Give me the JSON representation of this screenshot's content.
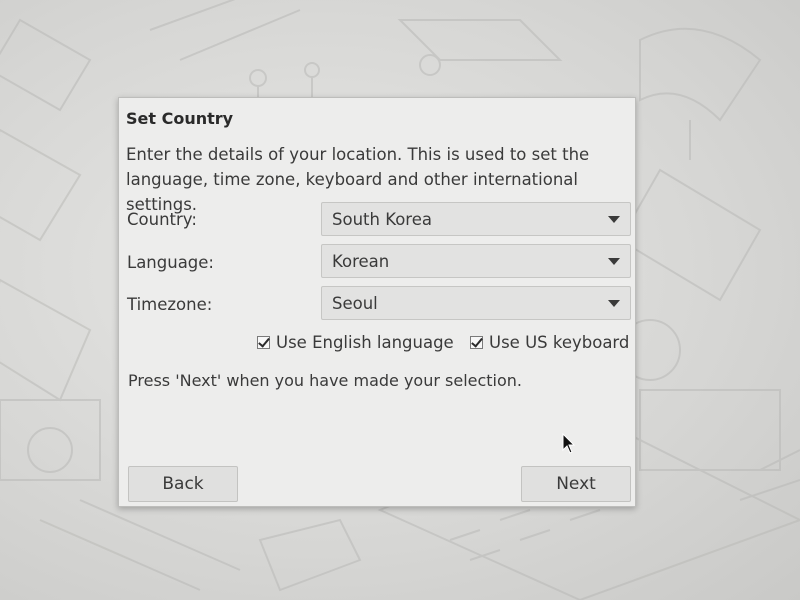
{
  "dialog": {
    "title": "Set Country",
    "description": "Enter the details of your location. This is used to set the language, time zone, keyboard and other international settings.",
    "fields": [
      {
        "label": "Country:",
        "value": "South Korea"
      },
      {
        "label": "Language:",
        "value": "Korean"
      },
      {
        "label": "Timezone:",
        "value": "Seoul"
      }
    ],
    "checkboxes": [
      {
        "label": "Use English language",
        "checked": true
      },
      {
        "label": "Use US keyboard",
        "checked": true
      }
    ],
    "hint": "Press 'Next' when you have made your selection.",
    "back_label": "Back",
    "next_label": "Next"
  },
  "icons": {
    "dropdown": "chevron-down-icon",
    "checkbox": "checkbox-checked-icon",
    "cursor": "mouse-pointer-icon"
  },
  "colors": {
    "dialog_bg": "#ededec",
    "wallpaper": "#d9d9d7",
    "text": "#3a3a3a"
  }
}
